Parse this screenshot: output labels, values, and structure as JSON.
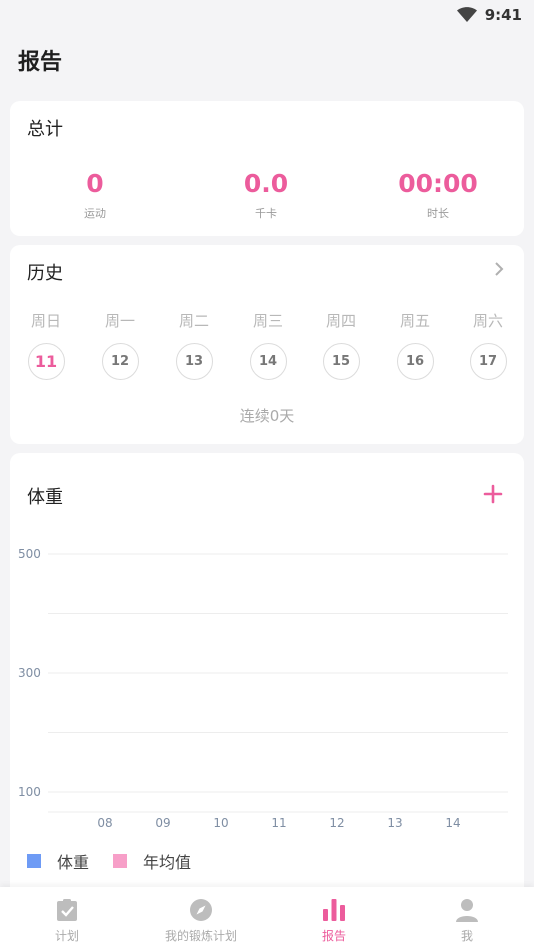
{
  "status_bar": {
    "time": "9:41"
  },
  "page": {
    "title": "报告"
  },
  "totals": {
    "title": "总计",
    "stats": [
      {
        "value": "0",
        "label": "运动"
      },
      {
        "value": "0.0",
        "label": "千卡"
      },
      {
        "value": "00:00",
        "label": "时长"
      }
    ]
  },
  "history": {
    "title": "历史",
    "days": [
      {
        "name": "周日",
        "date": "11",
        "active": true
      },
      {
        "name": "周一",
        "date": "12"
      },
      {
        "name": "周二",
        "date": "13"
      },
      {
        "name": "周三",
        "date": "14"
      },
      {
        "name": "周四",
        "date": "15"
      },
      {
        "name": "周五",
        "date": "16"
      },
      {
        "name": "周六",
        "date": "17"
      }
    ],
    "streak": "连续0天"
  },
  "weight": {
    "title": "体重",
    "chart_data": {
      "type": "line",
      "x": [
        "08",
        "09",
        "10",
        "11",
        "12",
        "13",
        "14"
      ],
      "ytick_labels": [
        "500",
        "300",
        "100"
      ],
      "ylim": [
        100,
        500
      ],
      "grid": true,
      "series": [
        {
          "name": "体重",
          "values": [],
          "color": "#6e9bf5"
        },
        {
          "name": "年均值",
          "values": [],
          "color": "#f79fc8"
        }
      ],
      "legend": "bottom-left"
    }
  },
  "nav": {
    "items": [
      {
        "label": "计划",
        "icon": "clipboard-check-icon"
      },
      {
        "label": "我的锻炼计划",
        "icon": "compass-icon"
      },
      {
        "label": "报告",
        "icon": "bar-chart-icon",
        "active": true
      },
      {
        "label": "我",
        "icon": "person-icon"
      }
    ]
  },
  "colors": {
    "accent": "#ec5c9c",
    "background": "#f4f4f6"
  }
}
